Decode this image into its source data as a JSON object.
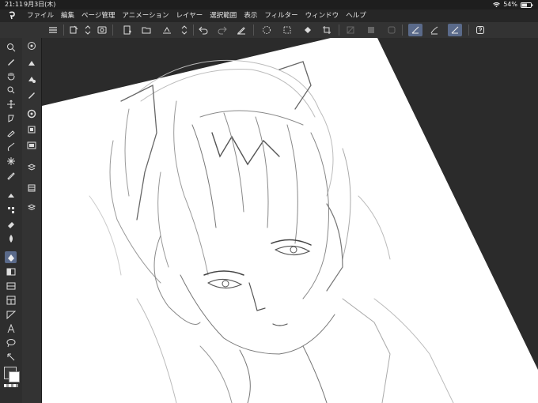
{
  "status": {
    "time": "21:11",
    "date": "9月3日(木)",
    "battery": "54%"
  },
  "menu": {
    "items": [
      "ファイル",
      "編集",
      "ページ管理",
      "アニメーション",
      "レイヤー",
      "選択範囲",
      "表示",
      "フィルター",
      "ウィンドウ",
      "ヘルプ"
    ]
  },
  "toolbar": {
    "icons": [
      "menu-icon",
      "new-file-icon",
      "open-file-icon",
      "settings-icon",
      "new-layer-icon",
      "folder-icon",
      "export-icon",
      "stepper-icon",
      "undo-icon",
      "redo-icon",
      "pen-clear-icon",
      "marquee-icon",
      "transform-icon",
      "fill-icon",
      "crop-icon",
      "hide-icon",
      "hide-icon",
      "hide-icon",
      "snap-ruler-icon",
      "snap-brush-icon",
      "snap-curve-icon",
      "help-icon"
    ]
  },
  "tools": {
    "main": [
      "zoom-icon",
      "hand-icon",
      "move-icon",
      "lasso-icon",
      "pen-icon",
      "pencil-icon",
      "brush-icon",
      "airbrush-icon",
      "decorate-icon",
      "eraser-icon",
      "blend-icon",
      "fill-icon",
      "gradient-icon",
      "figure-icon",
      "frame-icon",
      "ruler-icon",
      "text-icon",
      "balloon-icon",
      "correct-line-icon"
    ],
    "sub": [
      "navigator-icon",
      "brush-size-icon",
      "color-icon",
      "pen-settings-icon",
      "layer-icon",
      "material-icon",
      "color-wheel-icon",
      "history-icon",
      "layers-icon"
    ]
  },
  "colors": {
    "main": "#3a3a3a",
    "sub": "#ffffff",
    "accent": "#5a6a8a"
  }
}
